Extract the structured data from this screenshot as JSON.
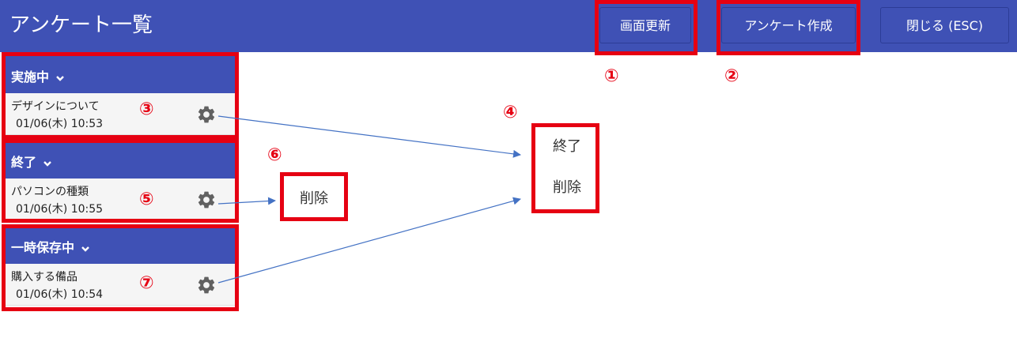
{
  "header": {
    "title": "アンケート一覧",
    "buttons": {
      "refresh": "画面更新",
      "create": "アンケート作成",
      "close": "閉じる (ESC)"
    }
  },
  "sections": [
    {
      "title": "実施中",
      "items": [
        {
          "name": "デザインについて",
          "date": "01/06(木) 10:53"
        }
      ]
    },
    {
      "title": "終了",
      "items": [
        {
          "name": "パソコンの種類",
          "date": "01/06(木) 10:55"
        }
      ]
    },
    {
      "title": "一時保存中",
      "items": [
        {
          "name": "購入する備品",
          "date": "01/06(木) 10:54"
        }
      ]
    }
  ],
  "popup_menu_active": {
    "items": [
      "終了",
      "削除"
    ]
  },
  "popup_menu_closed": {
    "items": [
      "削除"
    ]
  },
  "callouts": [
    "①",
    "②",
    "③",
    "④",
    "⑤",
    "⑥",
    "⑦"
  ],
  "colors": {
    "accent": "#3f51b5",
    "highlight": "#e60012",
    "arrow": "#4472c4"
  },
  "icons": {
    "section_toggle": "chevron-down-icon",
    "item_settings": "gear-icon"
  }
}
